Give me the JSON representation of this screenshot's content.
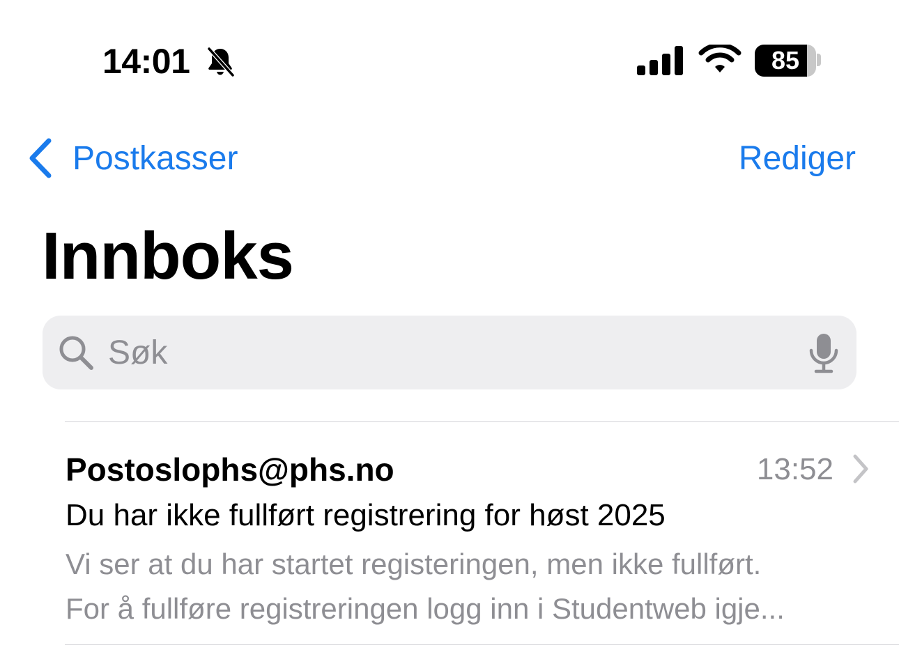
{
  "status_bar": {
    "time": "14:01",
    "battery": "85",
    "icons": [
      "bell-slash-icon",
      "cellular-signal-icon",
      "wifi-icon",
      "battery-icon"
    ]
  },
  "nav": {
    "back_label": "Postkasser",
    "edit_label": "Rediger"
  },
  "title": "Innboks",
  "search": {
    "placeholder": "Søk"
  },
  "colors": {
    "accent": "#1a7bec",
    "secondary_text": "#8e8e93",
    "search_bg": "#eeeef0"
  },
  "messages": [
    {
      "sender": "Postoslophs@phs.no",
      "time": "13:52",
      "subject": "Du har ikke fullført registrering for høst 2025",
      "preview_line1": "Vi ser at du har startet registeringen, men ikke fullført.",
      "preview_line2": "For å fullføre registreringen logg inn i Studentweb igje..."
    }
  ]
}
